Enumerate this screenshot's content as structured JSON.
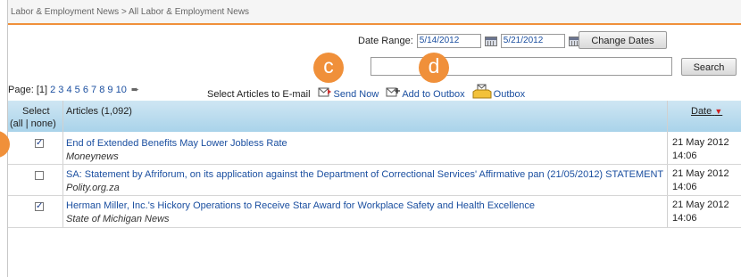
{
  "breadcrumb": "Labor & Employment News > All Labor & Employment News",
  "date_range": {
    "label": "Date Range:",
    "start": "5/14/2012",
    "end": "5/21/2012",
    "change_label": "Change Dates"
  },
  "search": {
    "value": "",
    "button_label": "Search"
  },
  "callouts": {
    "c": "c",
    "d": "d"
  },
  "pager": {
    "label": "Page:",
    "current": "[1]",
    "pages": [
      "2",
      "3",
      "4",
      "5",
      "6",
      "7",
      "8",
      "9",
      "10"
    ]
  },
  "email": {
    "label": "Select Articles to E-mail",
    "send_now": "Send Now",
    "add_to_outbox": "Add to Outbox",
    "outbox": "Outbox"
  },
  "table": {
    "select_header": "Select",
    "select_sub": "(all | none)",
    "articles_header": "Articles (1,092)",
    "date_header": "Date",
    "sort_indicator": "▼",
    "rows": [
      {
        "checked": true,
        "title": "End of Extended Benefits May Lower Jobless Rate",
        "source": "Moneynews",
        "date": "21 May 2012",
        "time": "14:06"
      },
      {
        "checked": false,
        "title": "SA: Statement by Afriforum, on its application against the Department of Correctional Services' Affirmative pan (21/05/2012) STATEMENT",
        "source": "Polity.org.za",
        "date": "21 May 2012",
        "time": "14:06"
      },
      {
        "checked": true,
        "title": "Herman Miller, Inc.'s Hickory Operations to Receive Star Award for Workplace Safety and Health Excellence",
        "source": "State of Michigan News",
        "date": "21 May 2012",
        "time": "14:06"
      }
    ]
  },
  "colors": {
    "accent_orange": "#f0903a",
    "link_blue": "#1b4fa0",
    "header_blue": "#a9d3ea"
  }
}
